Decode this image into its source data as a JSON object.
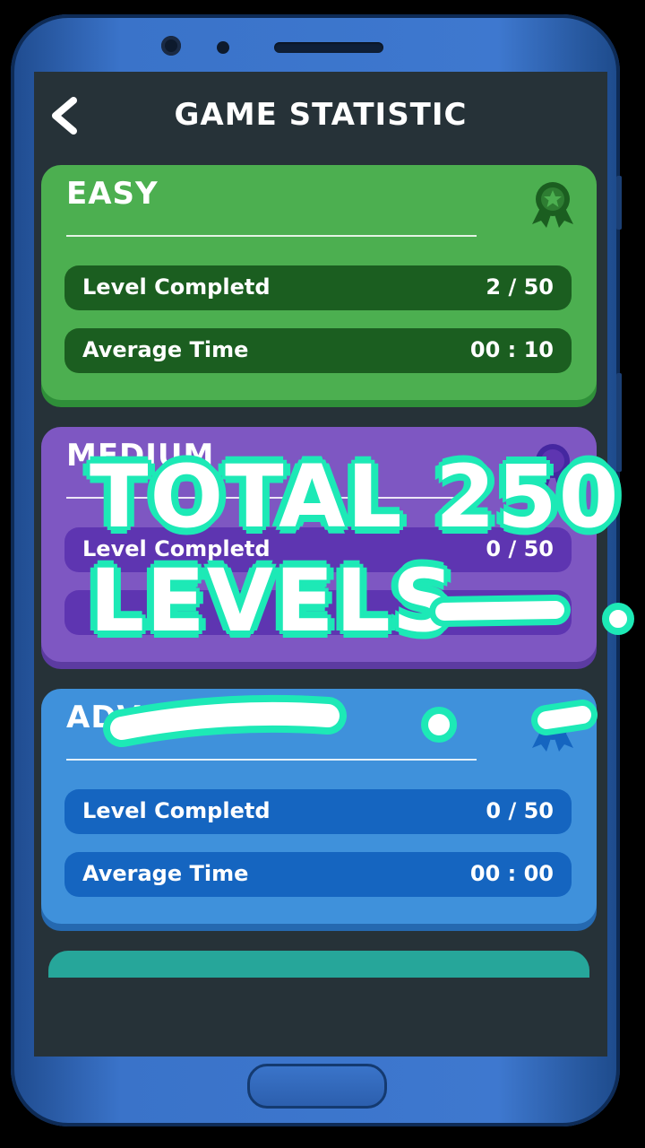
{
  "header": {
    "title": "GAME STATISTIC",
    "back_icon": "chevron-left-icon"
  },
  "cards": [
    {
      "title": "EASY",
      "color": "#4caf50",
      "badge_icon": "award-ribbon-icon",
      "stats": [
        {
          "label": "Level Completd",
          "value": "2 / 50"
        },
        {
          "label": "Average Time",
          "value": "00 : 10"
        }
      ]
    },
    {
      "title": "MEDIUM",
      "color": "#7e57c2",
      "badge_icon": "award-ribbon-icon",
      "stats": [
        {
          "label": "Level Completd",
          "value": "0 / 50"
        }
      ]
    },
    {
      "title": "ADVANCED",
      "color": "#3f91db",
      "badge_icon": "award-ribbon-icon",
      "stats": [
        {
          "label": "Level Completd",
          "value": "0 / 50"
        },
        {
          "label": "Average Time",
          "value": "00 : 00"
        }
      ]
    }
  ],
  "overlay": {
    "line1": "TOTAL 250",
    "line2": "LEVELS",
    "accent_color": "#1de9b6"
  }
}
